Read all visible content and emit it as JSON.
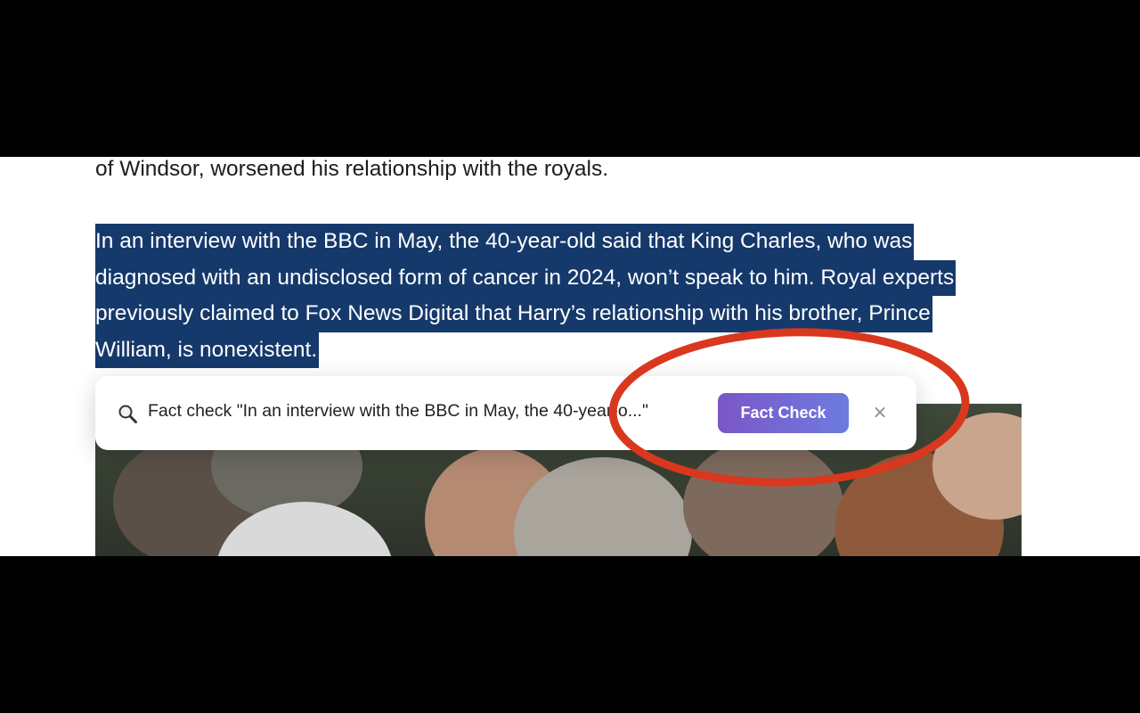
{
  "article": {
    "previous_line": "of Windsor, worsened his relationship with the royals.",
    "selected_lines": [
      "In an interview with the BBC in May, the 40-year-old said that King Charles, who was",
      "diagnosed with an undisclosed form of cancer in 2024, won’t speak to him. Royal experts",
      "previously claimed to Fox News Digital that Harry’s relationship with his brother, Prince",
      "William, is nonexistent."
    ]
  },
  "fact_check_bar": {
    "icon": "magnifier-icon",
    "prompt_text": "Fact check \"In an interview with the BBC in May, the 40-year-o...\"",
    "button_label": "Fact Check",
    "close_glyph": "×"
  },
  "annotation": {
    "color": "#d9381e",
    "shape": "ellipse around Fact Check button"
  },
  "colors": {
    "selection_bg": "#16396b",
    "button_gradient_start": "#7b56c8",
    "button_gradient_end": "#6d7be0"
  }
}
